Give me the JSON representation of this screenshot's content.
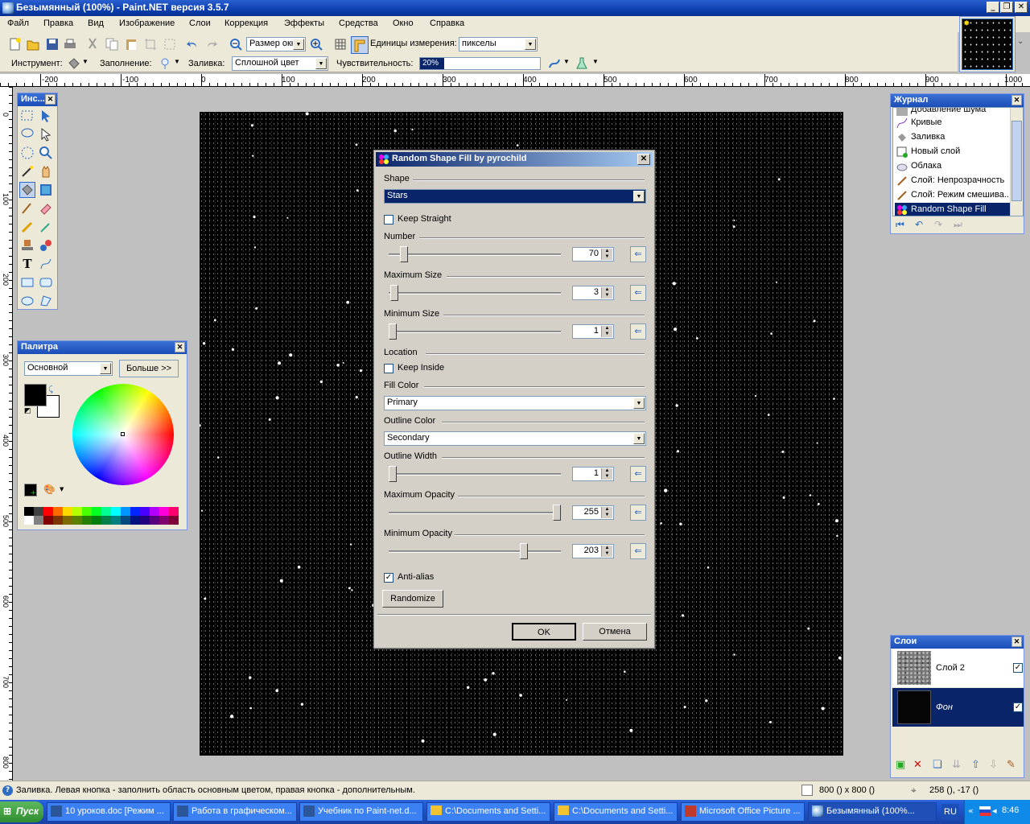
{
  "window": {
    "title": "Безымянный (100%) - Paint.NET версия 3.5.7"
  },
  "menu": [
    "Файл",
    "Правка",
    "Вид",
    "Изображение",
    "Слои",
    "Коррекция",
    "Эффекты",
    "Средства",
    "Окно",
    "Справка"
  ],
  "toolbar": {
    "zoom_value": "Размер окна",
    "units_label": "Единицы измерения:",
    "units_value": "пикселы",
    "tool_label": "Инструмент:",
    "fill_label": "Заполнение:",
    "flood_label": "Заливка:",
    "flood_value": "Сплошной цвет",
    "tolerance_label": "Чувствительность:",
    "tolerance_value": "20%",
    "tolerance_level": 0.2
  },
  "ruler_h": [
    "-200",
    "-100",
    "0",
    "100",
    "200",
    "300",
    "400",
    "500",
    "600",
    "700",
    "800",
    "900",
    "1000"
  ],
  "ruler_v": [
    "0",
    "100",
    "200",
    "300",
    "400",
    "500",
    "600",
    "700",
    "800"
  ],
  "tools_panel": {
    "title": "Инс..."
  },
  "palette": {
    "title": "Палитра",
    "mode": "Основной",
    "more_button": "Больше >>",
    "primary_color": "#000000",
    "secondary_color": "#ffffff",
    "swatches": [
      "#000000",
      "#404040",
      "#ff0000",
      "#ff6a00",
      "#ffd800",
      "#b6ff00",
      "#4cff00",
      "#00ff21",
      "#00ff90",
      "#00ffff",
      "#0094ff",
      "#0026ff",
      "#4800ff",
      "#b200ff",
      "#ff00dc",
      "#ff006e",
      "#ffffff",
      "#808080",
      "#7f0000",
      "#7f3300",
      "#7f6a00",
      "#5b7f00",
      "#267f00",
      "#007f0e",
      "#007f46",
      "#007f7f",
      "#004a7f",
      "#00137f",
      "#21007f",
      "#57007f",
      "#7f006e",
      "#7f0037"
    ]
  },
  "dialog": {
    "title": "Random Shape Fill by pyrochild",
    "shape_label": "Shape",
    "shape_value": "Stars",
    "keep_straight": "Keep Straight",
    "keep_straight_checked": false,
    "number_label": "Number",
    "number_value": "70",
    "number_level": 0.07,
    "max_size_label": "Maximum Size",
    "max_size_value": "3",
    "max_size_level": 0.01,
    "min_size_label": "Minimum Size",
    "min_size_value": "1",
    "min_size_level": 0.0,
    "location_label": "Location",
    "keep_inside": "Keep Inside",
    "keep_inside_checked": false,
    "fill_color_label": "Fill Color",
    "fill_color_value": "Primary",
    "outline_color_label": "Outline Color",
    "outline_color_value": "Secondary",
    "outline_width_label": "Outline Width",
    "outline_width_value": "1",
    "outline_width_level": 0.0,
    "max_opacity_label": "Maximum Opacity",
    "max_opacity_value": "255",
    "max_opacity_level": 1.0,
    "min_opacity_label": "Minimum Opacity",
    "min_opacity_value": "203",
    "min_opacity_level": 0.8,
    "antialias": "Anti-alias",
    "antialias_checked": true,
    "randomize": "Randomize",
    "ok": "OK",
    "cancel": "Отмена"
  },
  "history": {
    "title": "Журнал",
    "items": [
      "Добавление шума",
      "Кривые",
      "Заливка",
      "Новый слой",
      "Облака",
      "Слой: Непрозрачность",
      "Слой: Режим смешива...",
      "Random Shape Fill"
    ]
  },
  "layers": {
    "title": "Слои",
    "items": [
      {
        "name": "Слой 2",
        "visible": true
      },
      {
        "name": "Фон",
        "visible": true
      }
    ]
  },
  "status": {
    "hint": "Заливка. Левая кнопка - заполнить область основным цветом, правая кнопка - дополнительным.",
    "size": "800 () x 800 ()",
    "cursor": "258 (), -17 ()"
  },
  "taskbar": {
    "start": "Пуск",
    "tasks": [
      "10 уроков.doc [Режим ...",
      "Работа в графическом...",
      "Учебник по Paint-net.d...",
      "C:\\Documents and Setti...",
      "C:\\Documents and Setti...",
      "Microsoft Office Picture ...",
      "Безымянный (100%..."
    ],
    "lang": "RU",
    "clock": "8:46"
  }
}
